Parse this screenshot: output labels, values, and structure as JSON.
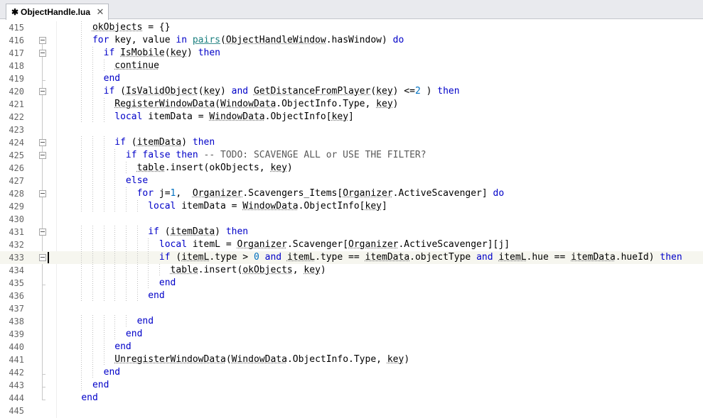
{
  "tab": {
    "filename": "ObjectHandle.lua",
    "modified_marker": "✱",
    "close_glyph": "✕"
  },
  "editor": {
    "current_line": 433,
    "lines": [
      {
        "n": "415",
        "fold": "",
        "tokens": [
          {
            "t": "      "
          },
          {
            "t": "okObjects",
            "c": "ul"
          },
          {
            "t": " = {}"
          }
        ]
      },
      {
        "n": "416",
        "fold": "box",
        "tokens": [
          {
            "t": "      "
          },
          {
            "t": "for",
            "c": "kw"
          },
          {
            "t": " key, value "
          },
          {
            "t": "in",
            "c": "kw"
          },
          {
            "t": " "
          },
          {
            "t": "pairs",
            "c": "fn"
          },
          {
            "t": "("
          },
          {
            "t": "ObjectHandleWindow",
            "c": "ul"
          },
          {
            "t": ".hasWindow) "
          },
          {
            "t": "do",
            "c": "kw"
          }
        ]
      },
      {
        "n": "417",
        "fold": "box",
        "tokens": [
          {
            "t": "        "
          },
          {
            "t": "if",
            "c": "kw"
          },
          {
            "t": " "
          },
          {
            "t": "IsMobile",
            "c": "ul"
          },
          {
            "t": "("
          },
          {
            "t": "key",
            "c": "ul"
          },
          {
            "t": ") "
          },
          {
            "t": "then",
            "c": "kw"
          }
        ]
      },
      {
        "n": "418",
        "fold": "",
        "tokens": [
          {
            "t": "          "
          },
          {
            "t": "continue",
            "c": "ul"
          }
        ]
      },
      {
        "n": "419",
        "fold": "end",
        "tokens": [
          {
            "t": "        "
          },
          {
            "t": "end",
            "c": "kw"
          }
        ]
      },
      {
        "n": "420",
        "fold": "box",
        "tokens": [
          {
            "t": "        "
          },
          {
            "t": "if",
            "c": "kw"
          },
          {
            "t": " ("
          },
          {
            "t": "IsValidObject",
            "c": "ul"
          },
          {
            "t": "("
          },
          {
            "t": "key",
            "c": "ul"
          },
          {
            "t": ") "
          },
          {
            "t": "and",
            "c": "kw"
          },
          {
            "t": " "
          },
          {
            "t": "GetDistanceFromPlayer",
            "c": "ul"
          },
          {
            "t": "("
          },
          {
            "t": "key",
            "c": "ul"
          },
          {
            "t": ") <="
          },
          {
            "t": "2",
            "c": "num"
          },
          {
            "t": " ) "
          },
          {
            "t": "then",
            "c": "kw"
          }
        ]
      },
      {
        "n": "421",
        "fold": "",
        "tokens": [
          {
            "t": "          "
          },
          {
            "t": "RegisterWindowData",
            "c": "ul"
          },
          {
            "t": "("
          },
          {
            "t": "WindowData",
            "c": "ul"
          },
          {
            "t": ".ObjectInfo.Type, "
          },
          {
            "t": "key",
            "c": "ul"
          },
          {
            "t": ")"
          }
        ]
      },
      {
        "n": "422",
        "fold": "",
        "tokens": [
          {
            "t": "          "
          },
          {
            "t": "local",
            "c": "kw"
          },
          {
            "t": " itemData = "
          },
          {
            "t": "WindowData",
            "c": "ul"
          },
          {
            "t": ".ObjectInfo["
          },
          {
            "t": "key",
            "c": "ul"
          },
          {
            "t": "]"
          }
        ]
      },
      {
        "n": "423",
        "fold": "",
        "tokens": [
          {
            "t": ""
          }
        ]
      },
      {
        "n": "424",
        "fold": "box",
        "tokens": [
          {
            "t": "          "
          },
          {
            "t": "if",
            "c": "kw"
          },
          {
            "t": " ("
          },
          {
            "t": "itemData",
            "c": "ul"
          },
          {
            "t": ") "
          },
          {
            "t": "then",
            "c": "kw"
          }
        ]
      },
      {
        "n": "425",
        "fold": "box",
        "tokens": [
          {
            "t": "            "
          },
          {
            "t": "if",
            "c": "kw"
          },
          {
            "t": " "
          },
          {
            "t": "false",
            "c": "kw"
          },
          {
            "t": " "
          },
          {
            "t": "then",
            "c": "kw"
          },
          {
            "t": " -- TODO: SCAVENGE ALL or USE THE FILTER?",
            "c": "cm"
          }
        ]
      },
      {
        "n": "426",
        "fold": "",
        "tokens": [
          {
            "t": "              "
          },
          {
            "t": "table",
            "c": "ul"
          },
          {
            "t": ".insert(okObjects, "
          },
          {
            "t": "key",
            "c": "ul"
          },
          {
            "t": ")"
          }
        ]
      },
      {
        "n": "427",
        "fold": "",
        "tokens": [
          {
            "t": "            "
          },
          {
            "t": "else",
            "c": "kw"
          }
        ]
      },
      {
        "n": "428",
        "fold": "box",
        "tokens": [
          {
            "t": "              "
          },
          {
            "t": "for",
            "c": "kw"
          },
          {
            "t": " j="
          },
          {
            "t": "1",
            "c": "num"
          },
          {
            "t": ",  "
          },
          {
            "t": "Organizer",
            "c": "ul"
          },
          {
            "t": ".Scavengers_Items["
          },
          {
            "t": "Organizer",
            "c": "ul"
          },
          {
            "t": ".ActiveScavenger] "
          },
          {
            "t": "do",
            "c": "kw"
          }
        ]
      },
      {
        "n": "429",
        "fold": "",
        "tokens": [
          {
            "t": "                "
          },
          {
            "t": "local",
            "c": "kw"
          },
          {
            "t": " itemData = "
          },
          {
            "t": "WindowData",
            "c": "ul"
          },
          {
            "t": ".ObjectInfo["
          },
          {
            "t": "key",
            "c": "ul"
          },
          {
            "t": "]"
          }
        ]
      },
      {
        "n": "430",
        "fold": "",
        "tokens": [
          {
            "t": ""
          }
        ]
      },
      {
        "n": "431",
        "fold": "box",
        "tokens": [
          {
            "t": "                "
          },
          {
            "t": "if",
            "c": "kw"
          },
          {
            "t": " ("
          },
          {
            "t": "itemData",
            "c": "ul"
          },
          {
            "t": ") "
          },
          {
            "t": "then",
            "c": "kw"
          }
        ]
      },
      {
        "n": "432",
        "fold": "",
        "tokens": [
          {
            "t": "                  "
          },
          {
            "t": "local",
            "c": "kw"
          },
          {
            "t": " itemL = "
          },
          {
            "t": "Organizer",
            "c": "ul"
          },
          {
            "t": ".Scavenger["
          },
          {
            "t": "Organizer",
            "c": "ul"
          },
          {
            "t": ".ActiveScavenger][j]"
          }
        ]
      },
      {
        "n": "433",
        "fold": "box",
        "tokens": [
          {
            "t": "                  "
          },
          {
            "t": "if",
            "c": "kw"
          },
          {
            "t": " ("
          },
          {
            "t": "itemL",
            "c": "ul"
          },
          {
            "t": ".type > "
          },
          {
            "t": "0",
            "c": "num"
          },
          {
            "t": " "
          },
          {
            "t": "and",
            "c": "kw"
          },
          {
            "t": " "
          },
          {
            "t": "itemL",
            "c": "ul"
          },
          {
            "t": ".type == "
          },
          {
            "t": "itemData",
            "c": "ul"
          },
          {
            "t": ".objectType "
          },
          {
            "t": "and",
            "c": "kw"
          },
          {
            "t": " "
          },
          {
            "t": "itemL",
            "c": "ul"
          },
          {
            "t": ".hue == "
          },
          {
            "t": "itemData",
            "c": "ul"
          },
          {
            "t": ".hueId) "
          },
          {
            "t": "then",
            "c": "kw"
          }
        ]
      },
      {
        "n": "434",
        "fold": "",
        "tokens": [
          {
            "t": "                    "
          },
          {
            "t": "table",
            "c": "ul"
          },
          {
            "t": ".insert("
          },
          {
            "t": "okObjects",
            "c": "ul"
          },
          {
            "t": ", "
          },
          {
            "t": "key",
            "c": "ul"
          },
          {
            "t": ")"
          }
        ]
      },
      {
        "n": "435",
        "fold": "end",
        "tokens": [
          {
            "t": "                  "
          },
          {
            "t": "end",
            "c": "kw"
          }
        ]
      },
      {
        "n": "436",
        "fold": "",
        "tokens": [
          {
            "t": "                "
          },
          {
            "t": "end",
            "c": "kw"
          }
        ]
      },
      {
        "n": "437",
        "fold": "",
        "tokens": [
          {
            "t": ""
          }
        ]
      },
      {
        "n": "438",
        "fold": "",
        "tokens": [
          {
            "t": "              "
          },
          {
            "t": "end",
            "c": "kw"
          }
        ]
      },
      {
        "n": "439",
        "fold": "",
        "tokens": [
          {
            "t": "            "
          },
          {
            "t": "end",
            "c": "kw"
          }
        ]
      },
      {
        "n": "440",
        "fold": "",
        "tokens": [
          {
            "t": "          "
          },
          {
            "t": "end",
            "c": "kw"
          }
        ]
      },
      {
        "n": "441",
        "fold": "",
        "tokens": [
          {
            "t": "          "
          },
          {
            "t": "UnregisterWindowData",
            "c": "ul"
          },
          {
            "t": "("
          },
          {
            "t": "WindowData",
            "c": "ul"
          },
          {
            "t": ".ObjectInfo.Type, "
          },
          {
            "t": "key",
            "c": "ul"
          },
          {
            "t": ")"
          }
        ]
      },
      {
        "n": "442",
        "fold": "end",
        "tokens": [
          {
            "t": "        "
          },
          {
            "t": "end",
            "c": "kw"
          }
        ]
      },
      {
        "n": "443",
        "fold": "end",
        "tokens": [
          {
            "t": "      "
          },
          {
            "t": "end",
            "c": "kw"
          }
        ]
      },
      {
        "n": "444",
        "fold": "end",
        "tokens": [
          {
            "t": "    "
          },
          {
            "t": "end",
            "c": "kw"
          }
        ]
      },
      {
        "n": "445",
        "fold": "",
        "tokens": [
          {
            "t": ""
          }
        ]
      }
    ]
  }
}
